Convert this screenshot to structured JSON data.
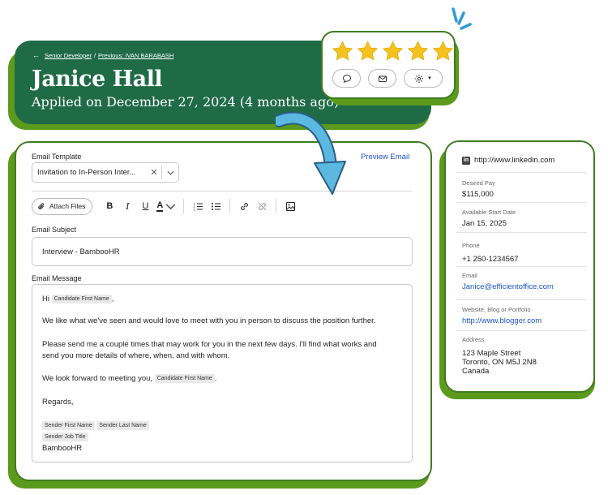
{
  "header": {
    "breadcrumb_current": "Senior Developer",
    "breadcrumb_separator": "/",
    "breadcrumb_previous": "Previous: IVAN BARABASH",
    "candidate_name": "Janice Hall",
    "applied_text": "Applied on December 27, 2024 (4 months ago)"
  },
  "rating": {
    "stars": 5,
    "max": 5,
    "star_color": "#f5c11e"
  },
  "email": {
    "template_label": "Email Template",
    "template_value": "Invitation to In-Person Inter...",
    "preview_label": "Preview Email",
    "attach_label": "Attach Files",
    "subject_label": "Email Subject",
    "subject_value": "Interview - BambooHR",
    "message_label": "Email Message",
    "greeting": "Hi",
    "greeting_comma": ",",
    "token_first_name": "Candidate First Name",
    "line1": "We like what we've seen and would love to meet with you in person to discuss the position further.",
    "line2a": "Please send me a couple times that may work for you in the next few days. I'll find what works and",
    "line2b": "send you more details of where, when, and with whom.",
    "line3": "We look forward to meeting you,",
    "line3_end": ".",
    "regards": "Regards,",
    "token_sender_first": "Sender First Name",
    "token_sender_last": "Sender Last Name",
    "token_sender_title": "Sender Job Title",
    "company": "BambooHR"
  },
  "profile": {
    "linkedin": "http://www.linkedin.com",
    "desired_pay_label": "Desired Pay",
    "desired_pay": "$115,000",
    "start_label": "Available Start Date",
    "start_date": "Jan 15, 2025",
    "phone_label": "Phone",
    "phone": "+1 250-1234567",
    "email_label": "Email",
    "email": "Janice@efficientoffice.com",
    "website_label": "Website, Blog or Portfolio",
    "website": "http://www.blogger.com",
    "address_label": "Address",
    "address_line1": "123 Maple Street",
    "address_line2": "Toronto, ON M5J 2N8",
    "address_line3": "Canada"
  },
  "colors": {
    "brand_green": "#1f6b46",
    "accent_lime": "#5b9a1c",
    "link_blue": "#1f55c8",
    "arrow_blue": "#5bb8e0"
  }
}
